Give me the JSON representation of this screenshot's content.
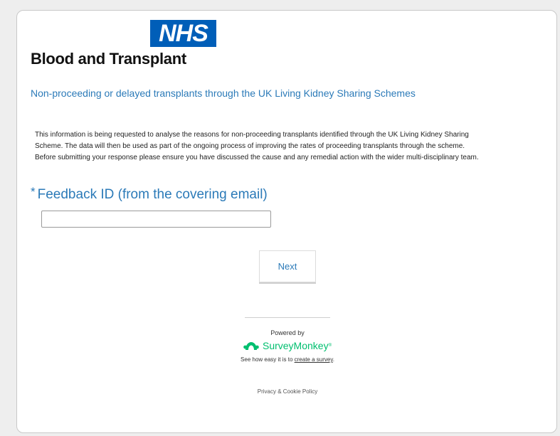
{
  "header": {
    "logo_mark": "NHS",
    "org_name": "Blood and Transplant"
  },
  "survey": {
    "title": "Non-proceeding or delayed transplants through the UK Living Kidney Sharing Schemes",
    "intro_lines": [
      "This information is being requested to analyse the reasons for non-proceeding transplants identified through the UK Living Kidney Sharing",
      "Scheme. The data will then be used as part of the ongoing process of improving the rates of proceeding transplants through the scheme.",
      "Before submitting your response please ensure you have discussed the cause and any remedial action with the wider multi-disciplinary team."
    ]
  },
  "question": {
    "required_marker": "*",
    "label": "Feedback ID (from the covering email)",
    "value": ""
  },
  "buttons": {
    "next": "Next"
  },
  "footer": {
    "powered_by": "Powered by",
    "brand": "SurveyMonkey",
    "brand_tm": "®",
    "promo_prefix": "See how easy it is to ",
    "promo_link": "create a survey",
    "promo_suffix": ".",
    "privacy": "Privacy & Cookie Policy"
  },
  "colors": {
    "nhs_blue": "#005eb8",
    "title_blue": "#2b7ab8",
    "surveymonkey_green": "#00bf6f"
  },
  "icons": {
    "brand_icon": "surveymonkey-logo-icon"
  }
}
